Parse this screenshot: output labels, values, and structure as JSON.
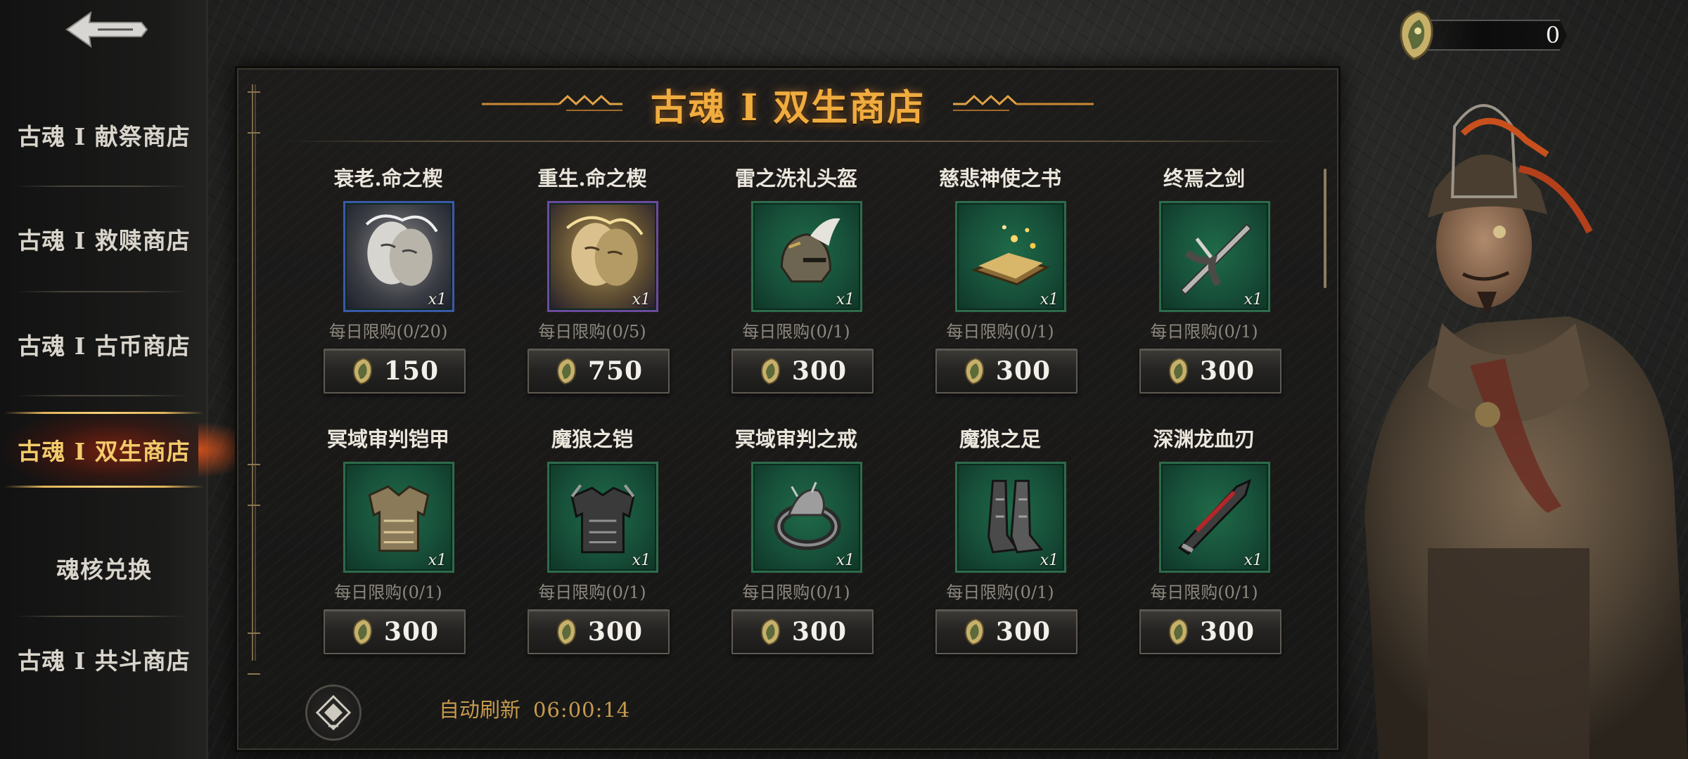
{
  "sidebar": {
    "back_label": "",
    "items": [
      {
        "label": "古魂 I 献祭商店",
        "active": false
      },
      {
        "label": "古魂 I 救赎商店",
        "active": false
      },
      {
        "label": "古魂 I 古币商店",
        "active": false
      },
      {
        "label": "古魂 I 双生商店",
        "active": true
      },
      {
        "label": "魂核兑换",
        "active": false
      },
      {
        "label": "古魂 I 共斗商店",
        "active": false
      }
    ]
  },
  "currency": {
    "value": "0",
    "icon": "soul-coin-icon"
  },
  "shop": {
    "title": "古魂 I 双生商店",
    "items": [
      {
        "name": "衰老.命之楔",
        "qty": "x1",
        "limit": "每日限购(0/20)",
        "price": "150",
        "rarity": "blue",
        "icon": "aged-wedge-icon"
      },
      {
        "name": "重生.命之楔",
        "qty": "x1",
        "limit": "每日限购(0/5)",
        "price": "750",
        "rarity": "purple",
        "icon": "reborn-wedge-icon"
      },
      {
        "name": "雷之洗礼头盔",
        "qty": "x1",
        "limit": "每日限购(0/1)",
        "price": "300",
        "rarity": "green",
        "icon": "helmet-icon"
      },
      {
        "name": "慈悲神使之书",
        "qty": "x1",
        "limit": "每日限购(0/1)",
        "price": "300",
        "rarity": "green",
        "icon": "book-icon"
      },
      {
        "name": "终焉之剑",
        "qty": "x1",
        "limit": "每日限购(0/1)",
        "price": "300",
        "rarity": "green",
        "icon": "sword-icon"
      },
      {
        "name": "冥域审判铠甲",
        "qty": "x1",
        "limit": "每日限购(0/1)",
        "price": "300",
        "rarity": "green",
        "icon": "armor-icon"
      },
      {
        "name": "魔狼之铠",
        "qty": "x1",
        "limit": "每日限购(0/1)",
        "price": "300",
        "rarity": "green",
        "icon": "wolf-armor-icon"
      },
      {
        "name": "冥域审判之戒",
        "qty": "x1",
        "limit": "每日限购(0/1)",
        "price": "300",
        "rarity": "green",
        "icon": "ring-icon"
      },
      {
        "name": "魔狼之足",
        "qty": "x1",
        "limit": "每日限购(0/1)",
        "price": "300",
        "rarity": "green",
        "icon": "greaves-icon"
      },
      {
        "name": "深渊龙血刃",
        "qty": "x1",
        "limit": "每日限购(0/1)",
        "price": "300",
        "rarity": "green",
        "icon": "blade-icon"
      }
    ]
  },
  "refresh": {
    "label": "自动刷新",
    "time": "06:00:14"
  },
  "colors": {
    "title": "#f0ac3f",
    "active_nav": "#f3cc6c",
    "frame_green": "#2d6b4b",
    "refresh": "#c69a4c"
  }
}
